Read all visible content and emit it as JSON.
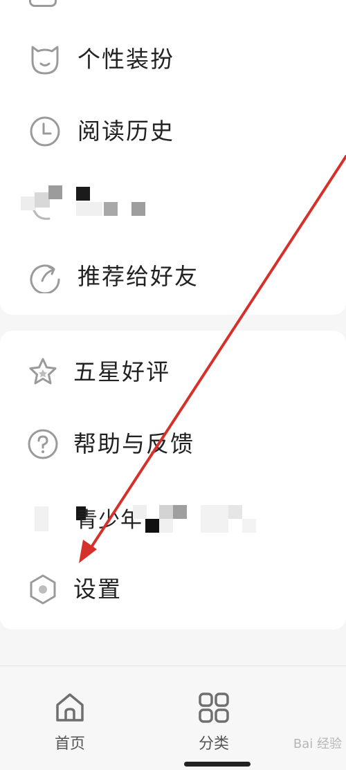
{
  "menu_top": {
    "items": [
      {
        "id": "theme",
        "label": "个性装扮",
        "icon": "cat-face-icon"
      },
      {
        "id": "history",
        "label": "阅读历史",
        "icon": "clock-icon"
      },
      {
        "id": "hidden",
        "label": "",
        "icon": "hidden-icon"
      },
      {
        "id": "share",
        "label": "推荐给好友",
        "icon": "share-arrow-icon"
      }
    ]
  },
  "menu_bottom": {
    "items": [
      {
        "id": "rate",
        "label": "五星好评",
        "icon": "star-icon"
      },
      {
        "id": "help",
        "label": "帮助与反馈",
        "icon": "question-icon"
      },
      {
        "id": "youth",
        "label": "青少年",
        "icon": "hidden-icon"
      },
      {
        "id": "settings",
        "label": "设置",
        "icon": "hexagon-gear-icon"
      }
    ]
  },
  "tabbar": {
    "tabs": [
      {
        "id": "home",
        "label": "首页",
        "icon": "home-icon"
      },
      {
        "id": "category",
        "label": "分类",
        "icon": "grid-icon"
      }
    ]
  },
  "watermark": "Bai 经验",
  "colors": {
    "arrow": "#d6302a",
    "icon": "#9a9a9a",
    "text": "#222222"
  }
}
